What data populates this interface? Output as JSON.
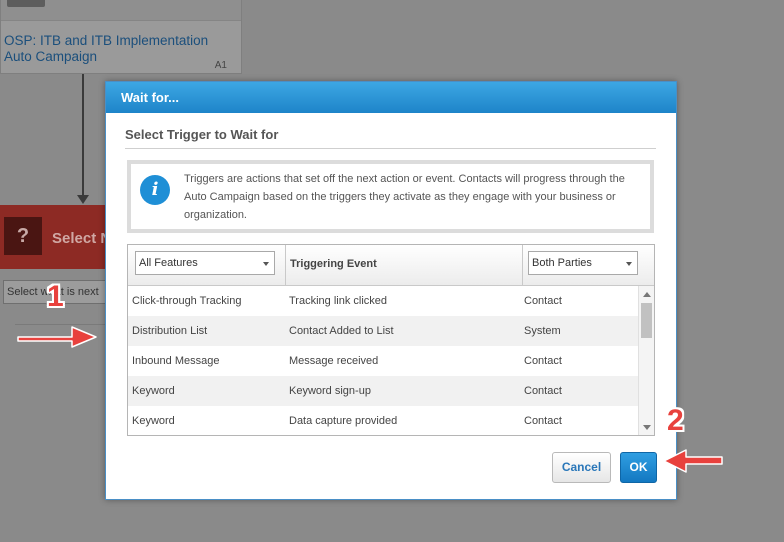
{
  "background": {
    "node_title": "OSP: ITB and ITB Implementation Auto Campaign",
    "node_code": "A1",
    "select_node_icon": "?",
    "select_node_label": "Select N",
    "select_next_placeholder": "Select what is next"
  },
  "dialog": {
    "title": "Wait for...",
    "subtitle": "Select Trigger to Wait for",
    "info_icon": "i",
    "info_text": "Triggers are actions that set off the next action or event. Contacts will progress through the Auto Campaign based on the triggers they activate as they engage with your business or organization.",
    "table": {
      "features_filter": "All Features",
      "event_header": "Triggering Event",
      "parties_filter": "Both Parties",
      "rows": [
        {
          "feature": "Click-through Tracking",
          "event": "Tracking link clicked",
          "party": "Contact"
        },
        {
          "feature": "Distribution List",
          "event": "Contact Added to List",
          "party": "System"
        },
        {
          "feature": "Inbound Message",
          "event": "Message received",
          "party": "Contact"
        },
        {
          "feature": "Keyword",
          "event": "Keyword sign-up",
          "party": "Contact"
        },
        {
          "feature": "Keyword",
          "event": "Data capture provided",
          "party": "Contact"
        }
      ]
    },
    "cancel_label": "Cancel",
    "ok_label": "OK"
  },
  "annotations": {
    "step1": "1",
    "step2": "2",
    "arrow_color": "#e8413d"
  },
  "colors": {
    "accent": "#1e84c9",
    "link": "#2a77b9",
    "select_node": "#8d2a24"
  }
}
